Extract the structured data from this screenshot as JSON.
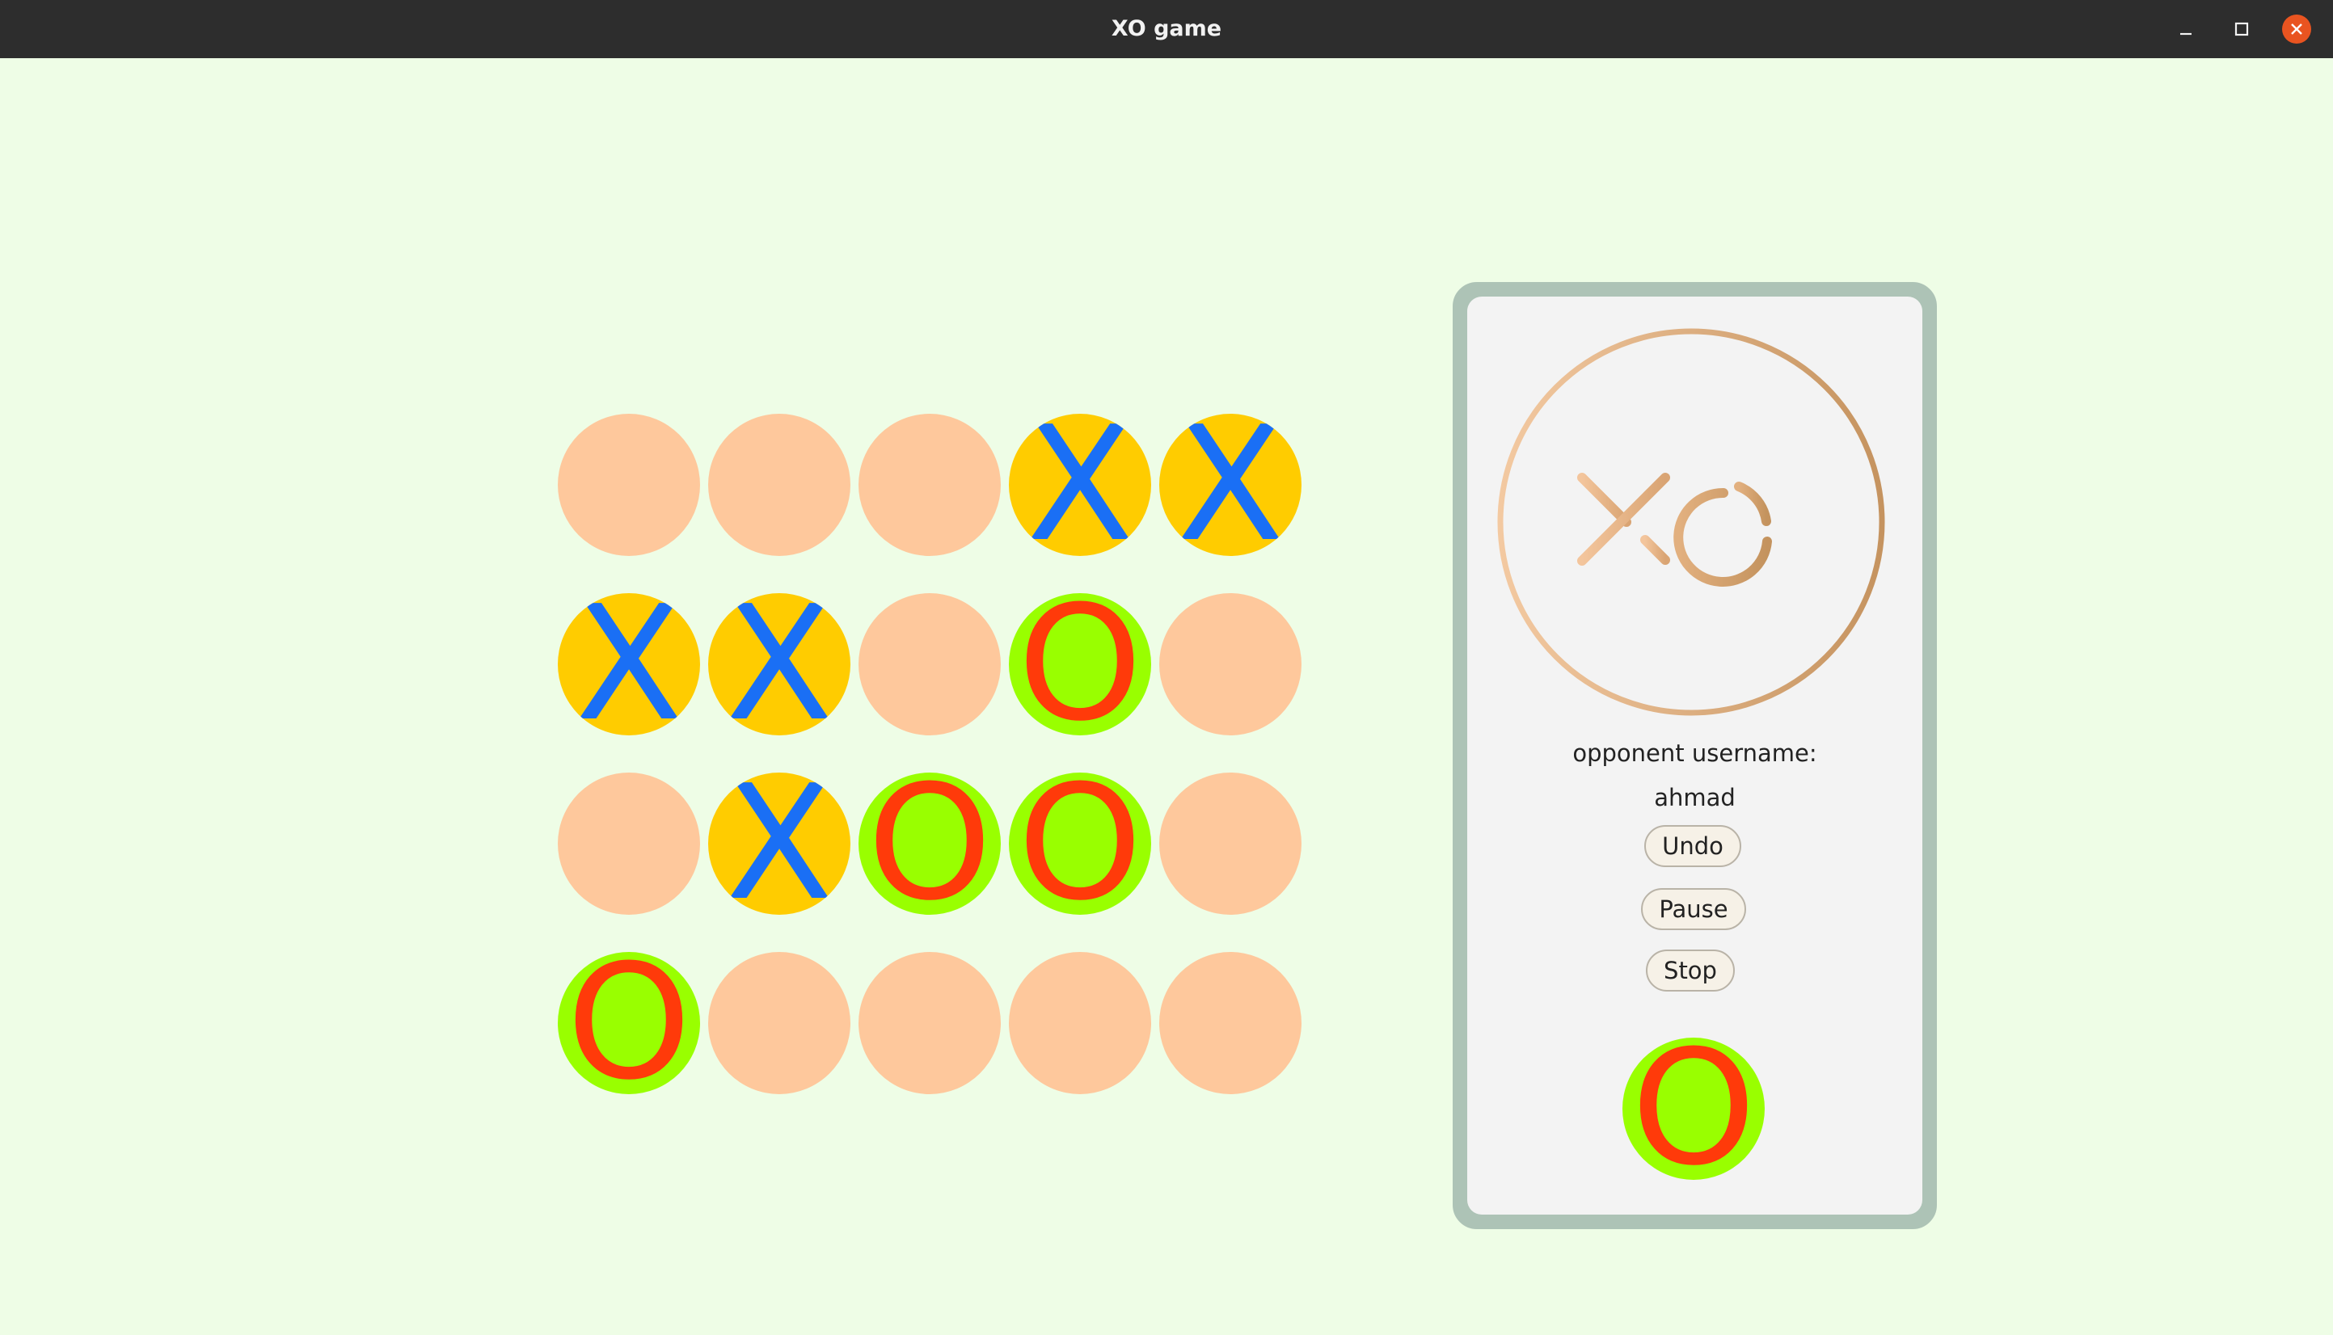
{
  "window": {
    "title": "XO game"
  },
  "icons": {
    "minimize": "minimize-icon",
    "maximize": "maximize-icon",
    "close": "close-icon",
    "logo": "xo-logo"
  },
  "colors": {
    "background": "#eefde6",
    "empty_cell": "#fec89c",
    "x_cell_bg": "#ffcc00",
    "x_mark": "#1a6ff5",
    "o_cell_bg": "#99ff00",
    "o_mark": "#ff3a0a",
    "panel_border": "#adc3b6",
    "panel_bg": "#f3f3f3",
    "close_button": "#e95420"
  },
  "board": {
    "rows": 4,
    "cols": 5,
    "cells": [
      [
        "",
        "",
        "",
        "X",
        "X"
      ],
      [
        "X",
        "X",
        "",
        "O",
        ""
      ],
      [
        "",
        "X",
        "O",
        "O",
        ""
      ],
      [
        "O",
        "",
        "",
        "",
        ""
      ]
    ]
  },
  "panel": {
    "opponent_label": "opponent username:",
    "opponent_name": "ahmad",
    "undo_label": "Undo",
    "pause_label": "Pause",
    "stop_label": "Stop",
    "current_turn": "O"
  }
}
